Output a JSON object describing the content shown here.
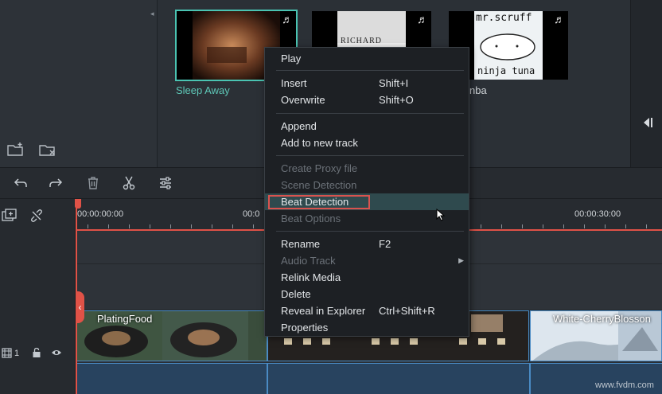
{
  "library": {
    "thumbnails": [
      {
        "label": "Sleep Away"
      },
      {
        "label": "RICHARD",
        "cover_text": "RICHARD"
      },
      {
        "label": "nba",
        "cover_text_top": "mr.scruff",
        "cover_text_bottom": "ninja tuna"
      }
    ]
  },
  "timeline": {
    "timecodes": [
      "00:00:00:00",
      "00:0",
      "00:00:30:00"
    ],
    "track_number": "1",
    "clips": [
      {
        "name": "PlatingFood"
      },
      {
        "name": ""
      },
      {
        "name": "White-CherryBlosson"
      }
    ]
  },
  "context_menu": {
    "items": [
      {
        "label": "Play",
        "shortcut": "",
        "disabled": false
      },
      {
        "label": "Insert",
        "shortcut": "Shift+I",
        "disabled": false
      },
      {
        "label": "Overwrite",
        "shortcut": "Shift+O",
        "disabled": false
      },
      {
        "label": "Append",
        "shortcut": "",
        "disabled": false
      },
      {
        "label": "Add to new track",
        "shortcut": "",
        "disabled": false
      },
      {
        "label": "Create Proxy file",
        "shortcut": "",
        "disabled": true
      },
      {
        "label": "Scene Detection",
        "shortcut": "",
        "disabled": true
      },
      {
        "label": "Beat Detection",
        "shortcut": "",
        "disabled": false,
        "highlighted": true
      },
      {
        "label": "Beat Options",
        "shortcut": "",
        "disabled": true
      },
      {
        "label": "Rename",
        "shortcut": "F2",
        "disabled": false
      },
      {
        "label": "Audio Track",
        "shortcut": "",
        "disabled": true,
        "submenu": true
      },
      {
        "label": "Relink Media",
        "shortcut": "",
        "disabled": false
      },
      {
        "label": "Delete",
        "shortcut": "",
        "disabled": false
      },
      {
        "label": "Reveal in Explorer",
        "shortcut": "Ctrl+Shift+R",
        "disabled": false
      },
      {
        "label": "Properties",
        "shortcut": "",
        "disabled": false
      }
    ]
  },
  "watermark": "www.fvdm.com",
  "colors": {
    "accent_teal": "#4ac3b2",
    "playhead_red": "#e05247",
    "highlight_border": "#d9534f",
    "clip_border": "#4a8bc4"
  }
}
